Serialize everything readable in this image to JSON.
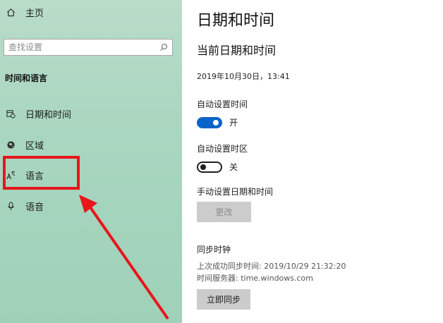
{
  "sidebar": {
    "home_label": "主页",
    "search_placeholder": "查找设置",
    "section_heading": "时间和语言",
    "items": [
      {
        "label": "日期和时间"
      },
      {
        "label": "区域"
      },
      {
        "label": "语言"
      },
      {
        "label": "语音"
      }
    ]
  },
  "main": {
    "title": "日期和时间",
    "subtitle": "当前日期和时间",
    "current_datetime": "2019年10月30日，13:41",
    "auto_time": {
      "label": "自动设置时间",
      "state": "开",
      "on": true
    },
    "auto_timezone": {
      "label": "自动设置时区",
      "state": "关",
      "on": false
    },
    "manual": {
      "label": "手动设置日期和时间",
      "button": "更改"
    },
    "sync": {
      "heading": "同步时钟",
      "last_sync": "上次成功同步时间: 2019/10/29 21:32:20",
      "server": "时间服务器: time.windows.com",
      "button": "立即同步"
    }
  },
  "annotation": {
    "color": "#e8161b"
  },
  "colors": {
    "accent": "#0a63c9",
    "sidebar_bg": "#a9d6c0"
  }
}
